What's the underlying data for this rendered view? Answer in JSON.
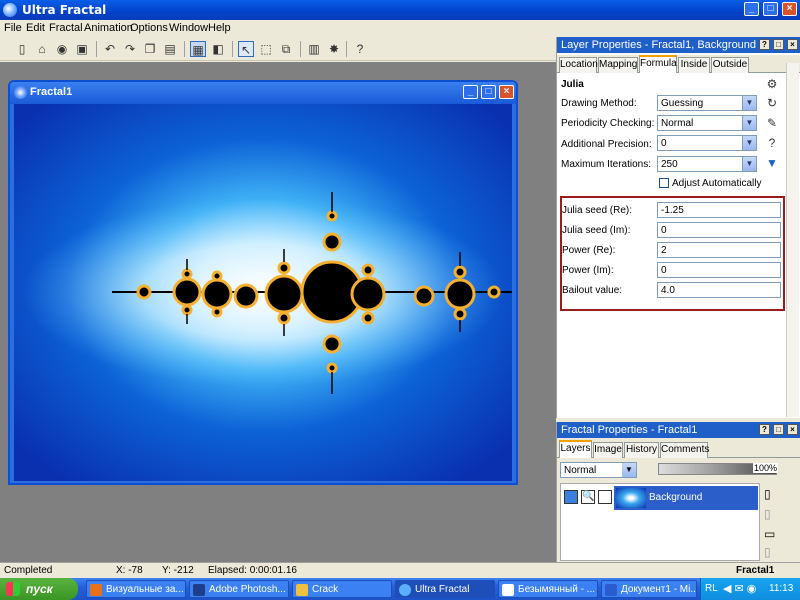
{
  "app": {
    "title": "Ultra Fractal"
  },
  "menu": [
    "File",
    "Edit",
    "Fractal",
    "Animation",
    "Options",
    "Window",
    "Help"
  ],
  "child_window": {
    "title": "Fractal1"
  },
  "layer_properties": {
    "title": "Layer Properties - Fractal1, Background",
    "tabs": [
      "Location",
      "Mapping",
      "Formula",
      "Inside",
      "Outside"
    ],
    "active_tab": "Formula",
    "formula_name": "Julia",
    "params": [
      {
        "label": "Drawing Method:",
        "value": "Guessing"
      },
      {
        "label": "Periodicity Checking:",
        "value": "Normal"
      },
      {
        "label": "Additional Precision:",
        "value": "0"
      },
      {
        "label": "Maximum Iterations:",
        "value": "250"
      }
    ],
    "adjust_label": "Adjust Automatically",
    "fields": [
      {
        "label": "Julia seed (Re):",
        "value": "-1.25"
      },
      {
        "label": "Julia seed (Im):",
        "value": "0"
      },
      {
        "label": "Power (Re):",
        "value": "2"
      },
      {
        "label": "Power (Im):",
        "value": "0"
      },
      {
        "label": "Bailout value:",
        "value": "4.0"
      }
    ]
  },
  "fractal_properties": {
    "title": "Fractal Properties - Fractal1",
    "tabs": [
      "Layers",
      "Image",
      "History",
      "Comments"
    ],
    "active_tab": "Layers",
    "blend_mode": "Normal",
    "opacity": "100%",
    "layer_name": "Background"
  },
  "status": {
    "state": "Completed",
    "x": "X: -78",
    "y": "Y: -212",
    "elapsed": "Elapsed: 0:00:01.16",
    "doc": "Fractal1"
  },
  "taskbar": {
    "start_label": "пуск",
    "tasks": [
      {
        "label": "Визуальные за...",
        "color": "#e8711a"
      },
      {
        "label": "Adobe Photosh...",
        "color": "#1d3e8a"
      },
      {
        "label": "Crack",
        "color": "#f0c040"
      },
      {
        "label": "Ultra Fractal",
        "color": "#5ab0ff"
      },
      {
        "label": "Безымянный - ...",
        "color": "#ffffff"
      },
      {
        "label": "Документ1 - Mi...",
        "color": "#2a5cd0"
      }
    ],
    "lang": "RL",
    "clock": "11:13"
  }
}
